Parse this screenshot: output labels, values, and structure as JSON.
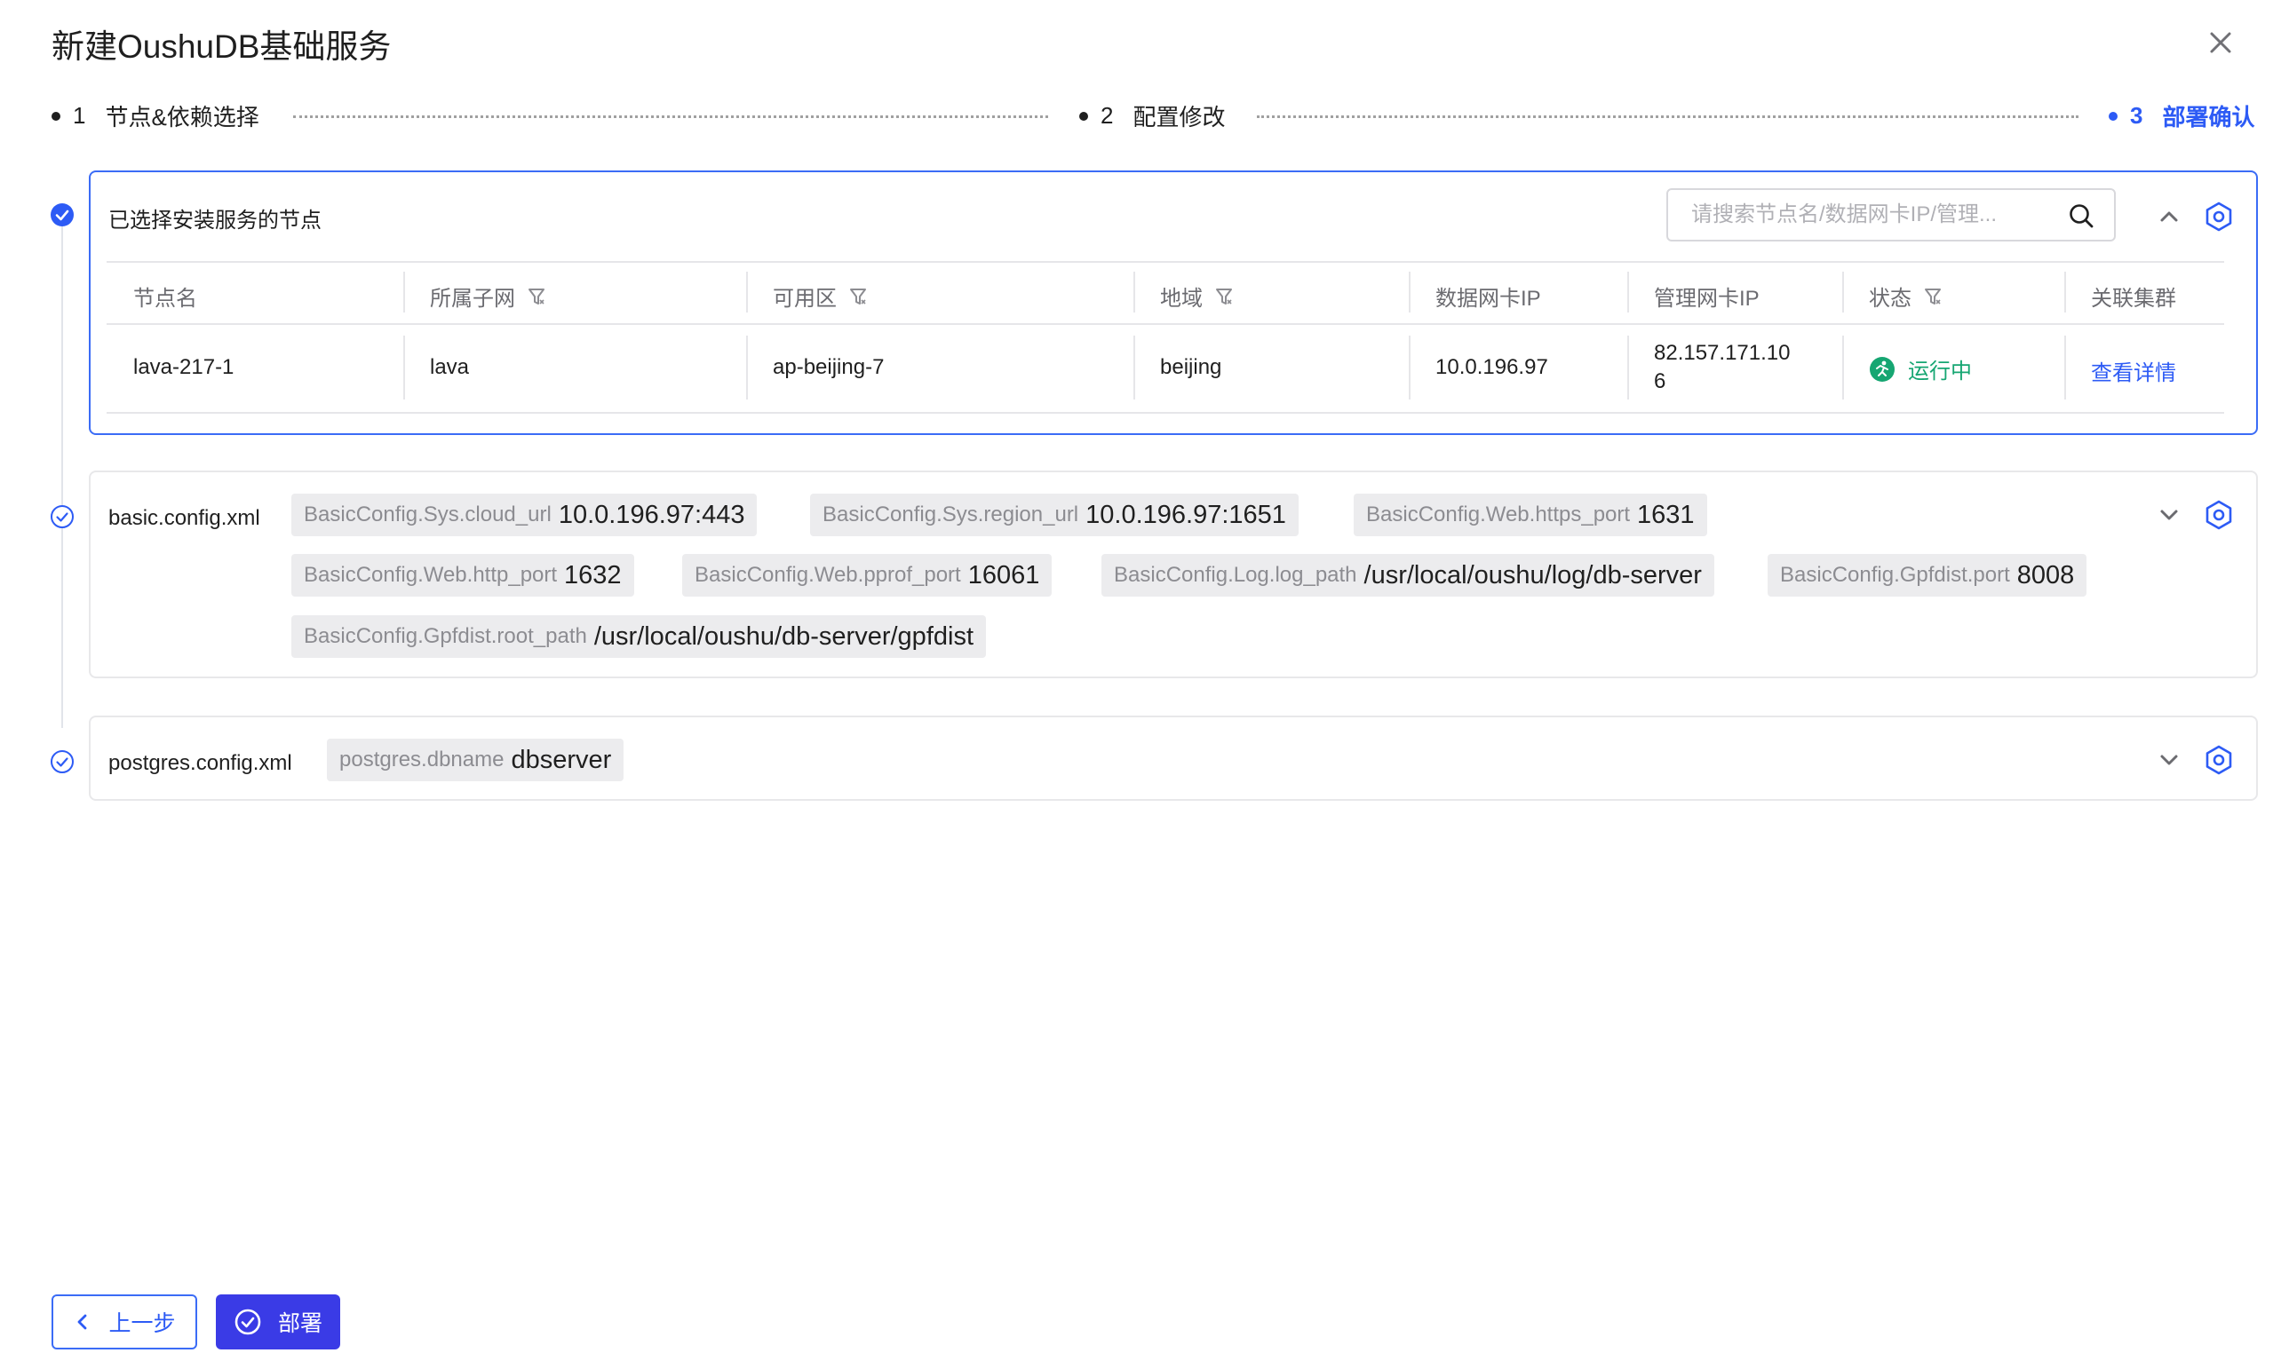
{
  "dialog": {
    "title": "新建OushuDB基础服务"
  },
  "steps": [
    {
      "num": "1",
      "label": "节点&依赖选择"
    },
    {
      "num": "2",
      "label": "配置修改"
    },
    {
      "num": "3",
      "label": "部署确认"
    }
  ],
  "nodes_panel": {
    "title": "已选择安装服务的节点",
    "search_placeholder": "请搜索节点名/数据网卡IP/管理...",
    "columns": [
      "节点名",
      "所属子网",
      "可用区",
      "地域",
      "数据网卡IP",
      "管理网卡IP",
      "状态",
      "关联集群"
    ],
    "rows": [
      {
        "name": "lava-217-1",
        "subnet": "lava",
        "zone": "ap-beijing-7",
        "region": "beijing",
        "data_ip": "10.0.196.97",
        "mgmt_ip_line1": "82.157.171.10",
        "mgmt_ip_line2": "6",
        "status": "运行中",
        "cluster_link": "查看详情"
      }
    ]
  },
  "configs": [
    {
      "file": "basic.config.xml",
      "items": [
        {
          "key": "BasicConfig.Sys.cloud_url",
          "value": "10.0.196.97:443"
        },
        {
          "key": "BasicConfig.Sys.region_url",
          "value": "10.0.196.97:1651"
        },
        {
          "key": "BasicConfig.Web.https_port",
          "value": "1631"
        },
        {
          "key": "BasicConfig.Web.http_port",
          "value": "1632"
        },
        {
          "key": "BasicConfig.Web.pprof_port",
          "value": "16061"
        },
        {
          "key": "BasicConfig.Log.log_path",
          "value": "/usr/local/oushu/log/db-server"
        },
        {
          "key": "BasicConfig.Gpfdist.port",
          "value": "8008"
        },
        {
          "key": "BasicConfig.Gpfdist.root_path",
          "value": "/usr/local/oushu/db-server/gpfdist"
        }
      ]
    },
    {
      "file": "postgres.config.xml",
      "items": [
        {
          "key": "postgres.dbname",
          "value": "dbserver"
        }
      ]
    }
  ],
  "footer": {
    "prev_label": "上一步",
    "deploy_label": "部署"
  },
  "colors": {
    "primary": "#2d5bf5",
    "deploy_bg": "#3a3be6",
    "running": "#16a672"
  },
  "icons": [
    "close-icon",
    "search-icon",
    "chevron-up-icon",
    "chevron-down-icon",
    "settings-icon",
    "filter-icon",
    "check-circle-icon",
    "running-icon",
    "chevron-left-icon"
  ]
}
